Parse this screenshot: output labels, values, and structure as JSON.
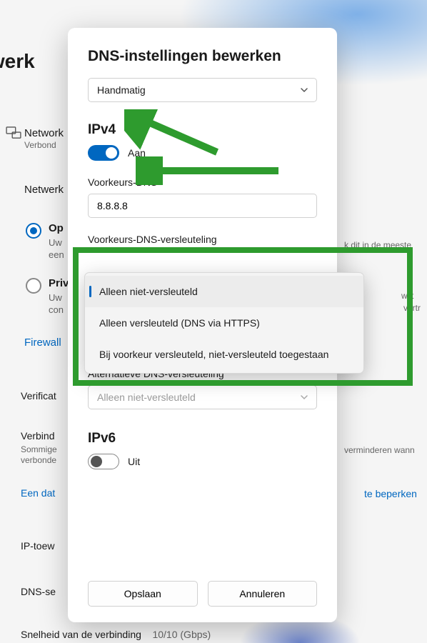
{
  "background": {
    "page_title": "etwerk",
    "network_label": "Network",
    "network_sub": "Verbond",
    "netwerk_profile_label": "Netwerk",
    "radio_public_label": "Op",
    "radio_public_sub1": "Uw",
    "radio_public_sub2": "een",
    "radio_private_label": "Priv",
    "radio_private_sub1": "Uw",
    "radio_private_sub2": "con",
    "firewall_link": "Firewall",
    "verificatie": "Verificat",
    "verbind_label": "Verbind",
    "verbind_sub": "Sommige",
    "verbind_sub2": "verbonde",
    "een_dat_link": "Een dat",
    "ip_toew": "IP-toew",
    "dns_se": "DNS-se",
    "snelheid_label": "Snelheid van de verbinding",
    "snelheid_value": "10/10 (Gbps)",
    "right_dit_in": "k dit in de meeste",
    "right_wilt": "wilt",
    "right_vertr": "vertr",
    "right_vermind": "verminderen wann",
    "right_beperken": "te beperken"
  },
  "modal": {
    "title": "DNS-instellingen bewerken",
    "mode_dropdown": {
      "value": "Handmatig"
    },
    "ipv4": {
      "heading": "IPv4",
      "toggle_label": "Aan",
      "toggle_on": true
    },
    "pref_dns": {
      "label": "Voorkeurs-DNS",
      "value": "8.8.8.8"
    },
    "pref_enc": {
      "label": "Voorkeurs-DNS-versleuteling",
      "options": [
        "Alleen niet-versleuteld",
        "Alleen versleuteld (DNS via HTTPS)",
        "Bij voorkeur versleuteld, niet-versleuteld toegestaan"
      ],
      "selected_index": 0
    },
    "alt_enc": {
      "label": "Alternatieve DNS-versleuteling",
      "value": "Alleen niet-versleuteld"
    },
    "ipv6": {
      "heading": "IPv6",
      "toggle_label": "Uit",
      "toggle_on": false
    },
    "buttons": {
      "save": "Opslaan",
      "cancel": "Annuleren"
    }
  },
  "colors": {
    "accent": "#0067c0",
    "anno_green": "#2e9b2e"
  }
}
